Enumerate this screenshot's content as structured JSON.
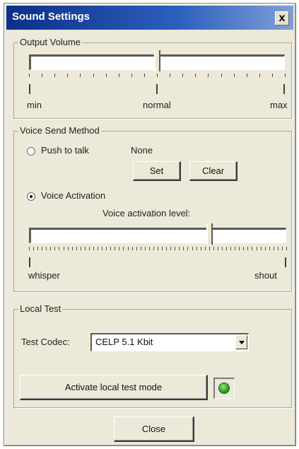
{
  "window": {
    "title": "Sound Settings",
    "close_label": "x"
  },
  "output_volume": {
    "legend": "Output Volume",
    "level": 0.5,
    "labels": {
      "min": "min",
      "normal": "normal",
      "max": "max"
    }
  },
  "voice_send": {
    "legend": "Voice Send Method",
    "push_to_talk": {
      "label": "Push to talk",
      "selected": false
    },
    "hotkey_value": "None",
    "set_label": "Set",
    "clear_label": "Clear",
    "voice_activation": {
      "label": "Voice Activation",
      "selected": true
    },
    "level_label": "Voice activation level:",
    "level": 0.7,
    "labels": {
      "low": "whisper",
      "high": "shout"
    }
  },
  "local_test": {
    "legend": "Local Test",
    "codec_label": "Test Codec:",
    "codec_value": "CELP 5.1 Kbit",
    "activate_label": "Activate local test mode",
    "indicator_color": "#2f9a28"
  },
  "footer": {
    "close_label": "Close"
  }
}
